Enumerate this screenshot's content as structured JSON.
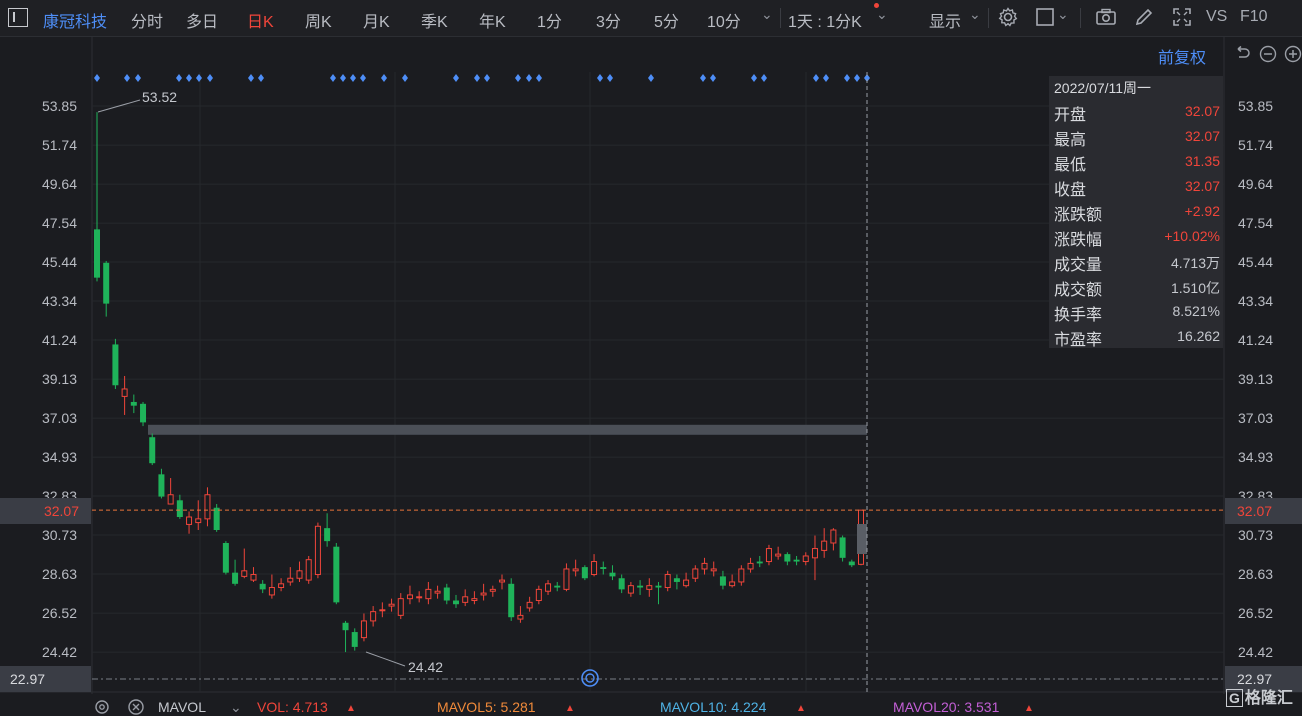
{
  "topbar": {
    "stock_name": "康冠科技",
    "timeframes": [
      "分时",
      "多日",
      "日K",
      "周K",
      "月K",
      "季K",
      "年K",
      "1分",
      "3分",
      "5分",
      "10分"
    ],
    "active_timeframe": "日K",
    "interval_select": "1天 : 1分K",
    "display_label": "显示",
    "vs_label": "VS",
    "f10_label": "F10"
  },
  "adjust_label": "前复权",
  "price_axis_ticks": [
    "53.85",
    "51.74",
    "49.64",
    "47.54",
    "45.44",
    "43.34",
    "41.24",
    "39.13",
    "37.03",
    "34.93",
    "32.83",
    "30.73",
    "28.63",
    "26.52",
    "24.42",
    "22.97"
  ],
  "current_price_tag": "32.07",
  "low_price_tag": "22.97",
  "annotations": {
    "high": "53.52",
    "low": "24.42"
  },
  "info_panel": {
    "date": "2022/07/11周一",
    "rows": [
      {
        "label": "开盘",
        "value": "32.07",
        "color": "red"
      },
      {
        "label": "最高",
        "value": "32.07",
        "color": "red"
      },
      {
        "label": "最低",
        "value": "31.35",
        "color": "red"
      },
      {
        "label": "收盘",
        "value": "32.07",
        "color": "red"
      },
      {
        "label": "涨跌额",
        "value": "+2.92",
        "color": "red"
      },
      {
        "label": "涨跌幅",
        "value": "+10.02%",
        "color": "red"
      },
      {
        "label": "成交量",
        "value": "4.713万",
        "color": "grey"
      },
      {
        "label": "成交额",
        "value": "1.510亿",
        "color": "grey"
      },
      {
        "label": "换手率",
        "value": "8.521%",
        "color": "grey"
      },
      {
        "label": "市盈率",
        "value": "16.262",
        "color": "grey"
      }
    ]
  },
  "bottom_bar": {
    "indicator": "MAVOL",
    "vol": "VOL: 4.713",
    "mavol5": "MAVOL5: 5.281",
    "mavol10": "MAVOL10: 4.224",
    "mavol20": "MAVOL20: 3.531"
  },
  "watermark": "格隆汇",
  "colors": {
    "up": "#f0453a",
    "down": "#1fb35a",
    "accent": "#4e8ef7",
    "crosshair": "#e8743b"
  },
  "chart_data": {
    "type": "candlestick",
    "ylim": [
      22.97,
      53.85
    ],
    "candles": [
      [
        47.2,
        44.6,
        53.52,
        44.4
      ],
      [
        45.4,
        43.2,
        45.5,
        42.5
      ],
      [
        41.0,
        38.8,
        41.3,
        38.6
      ],
      [
        38.2,
        38.6,
        39.3,
        37.2
      ],
      [
        37.9,
        37.7,
        38.3,
        37.3
      ],
      [
        37.8,
        36.8,
        37.9,
        36.6
      ],
      [
        36.0,
        34.6,
        36.2,
        34.5
      ],
      [
        34.0,
        32.8,
        34.3,
        32.7
      ],
      [
        32.4,
        32.9,
        33.8,
        32.6
      ],
      [
        32.6,
        31.7,
        32.9,
        31.6
      ],
      [
        31.3,
        31.7,
        32.0,
        30.8
      ],
      [
        31.4,
        31.6,
        32.6,
        31.0
      ],
      [
        31.6,
        32.9,
        33.3,
        31.2
      ],
      [
        32.2,
        31.0,
        32.4,
        30.9
      ],
      [
        30.3,
        28.7,
        30.4,
        28.6
      ],
      [
        28.7,
        28.1,
        29.4,
        28.0
      ],
      [
        28.5,
        28.8,
        30.0,
        28.4
      ],
      [
        28.3,
        28.6,
        29.0,
        28.2
      ],
      [
        28.1,
        27.8,
        28.3,
        27.6
      ],
      [
        27.5,
        27.9,
        28.6,
        27.3
      ],
      [
        27.9,
        28.1,
        28.4,
        27.7
      ],
      [
        28.2,
        28.4,
        29.0,
        28.0
      ],
      [
        28.4,
        28.8,
        29.3,
        28.2
      ],
      [
        28.3,
        29.4,
        29.6,
        28.1
      ],
      [
        28.6,
        31.2,
        31.4,
        28.4
      ],
      [
        31.1,
        30.4,
        31.9,
        30.1
      ],
      [
        30.1,
        27.1,
        30.3,
        27.0
      ],
      [
        26.0,
        25.6,
        26.1,
        24.42
      ],
      [
        25.5,
        24.7,
        25.7,
        24.5
      ],
      [
        25.2,
        26.1,
        26.5,
        25.0
      ],
      [
        26.1,
        26.6,
        26.9,
        25.8
      ],
      [
        26.7,
        26.7,
        27.1,
        26.3
      ],
      [
        26.9,
        27.0,
        27.3,
        26.6
      ],
      [
        26.4,
        27.3,
        27.6,
        26.2
      ],
      [
        27.3,
        27.5,
        28.0,
        27.0
      ],
      [
        27.4,
        27.4,
        27.7,
        27.1
      ],
      [
        27.3,
        27.8,
        28.2,
        27.0
      ],
      [
        27.6,
        27.7,
        28.0,
        27.3
      ],
      [
        27.9,
        27.2,
        28.1,
        27.0
      ],
      [
        27.2,
        27.0,
        27.5,
        26.8
      ],
      [
        27.1,
        27.4,
        27.8,
        26.9
      ],
      [
        27.2,
        27.3,
        27.7,
        27.0
      ],
      [
        27.5,
        27.6,
        28.1,
        27.2
      ],
      [
        27.7,
        27.8,
        28.0,
        27.4
      ],
      [
        28.2,
        28.3,
        28.6,
        27.8
      ],
      [
        28.1,
        26.3,
        28.4,
        26.1
      ],
      [
        26.2,
        26.4,
        26.9,
        26.0
      ],
      [
        26.8,
        27.1,
        27.4,
        26.6
      ],
      [
        27.2,
        27.8,
        28.0,
        27.0
      ],
      [
        27.7,
        28.1,
        28.3,
        27.5
      ],
      [
        28.0,
        27.9,
        28.2,
        27.7
      ],
      [
        27.8,
        28.9,
        29.2,
        27.7
      ],
      [
        28.8,
        28.9,
        29.4,
        28.5
      ],
      [
        29.0,
        28.4,
        29.1,
        28.3
      ],
      [
        28.6,
        29.3,
        29.7,
        28.5
      ],
      [
        29.0,
        28.9,
        29.3,
        28.6
      ],
      [
        28.7,
        28.5,
        29.1,
        28.3
      ],
      [
        28.4,
        27.8,
        28.6,
        27.6
      ],
      [
        27.6,
        28.0,
        28.2,
        27.4
      ],
      [
        28.0,
        27.9,
        28.3,
        27.5
      ],
      [
        27.8,
        28.0,
        28.4,
        27.4
      ],
      [
        28.0,
        27.9,
        28.2,
        27.0
      ],
      [
        27.9,
        28.6,
        28.8,
        27.7
      ],
      [
        28.4,
        28.2,
        28.6,
        27.8
      ],
      [
        28.0,
        28.3,
        28.7,
        27.9
      ],
      [
        28.4,
        28.9,
        29.1,
        28.2
      ],
      [
        28.9,
        29.2,
        29.5,
        28.6
      ],
      [
        28.8,
        28.9,
        29.3,
        28.5
      ],
      [
        28.5,
        28.0,
        28.8,
        27.8
      ],
      [
        28.0,
        28.2,
        28.6,
        27.9
      ],
      [
        28.2,
        28.9,
        29.1,
        28.0
      ],
      [
        28.9,
        29.2,
        29.5,
        28.7
      ],
      [
        29.3,
        29.2,
        29.6,
        29.0
      ],
      [
        29.3,
        30.0,
        30.2,
        29.1
      ],
      [
        29.6,
        29.7,
        30.1,
        29.4
      ],
      [
        29.7,
        29.3,
        29.8,
        29.1
      ],
      [
        29.4,
        29.3,
        29.6,
        29.1
      ],
      [
        29.3,
        29.6,
        29.8,
        29.1
      ],
      [
        29.5,
        30.0,
        30.7,
        28.3
      ],
      [
        29.9,
        30.4,
        31.1,
        29.5
      ],
      [
        30.3,
        31.0,
        31.1,
        29.9
      ],
      [
        30.6,
        29.5,
        30.7,
        29.3
      ],
      [
        29.3,
        29.1,
        29.4,
        29.0
      ],
      [
        29.15,
        32.07,
        32.07,
        29.1
      ]
    ],
    "markers_count": 34,
    "gray_band_price": 36.4
  }
}
